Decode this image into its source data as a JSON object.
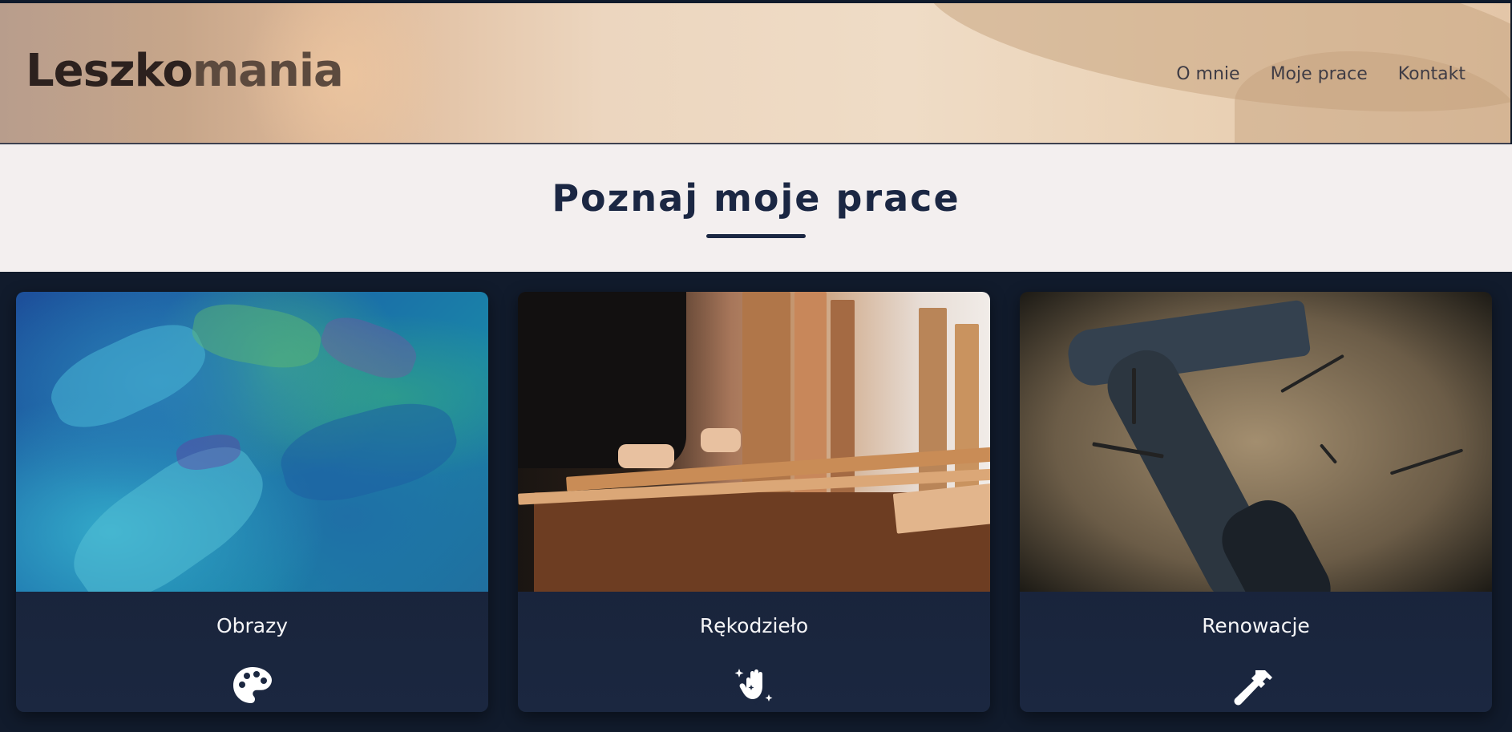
{
  "header": {
    "logo_part1": "Leszko",
    "logo_part2": "mania",
    "nav": [
      "O mnie",
      "Moje prace",
      "Kontakt"
    ]
  },
  "intro": {
    "title": "Poznaj moje prace"
  },
  "cards": [
    {
      "title": "Obrazy",
      "icon": "palette-icon"
    },
    {
      "title": "Rękodzieło",
      "icon": "sparkle-hand-icon"
    },
    {
      "title": "Renowacje",
      "icon": "hammer-icon"
    }
  ],
  "colors": {
    "heading": "#1b2743",
    "card_bg": "#1b2740",
    "page_bg": "#111b2c",
    "intro_bg": "#f3efef"
  }
}
